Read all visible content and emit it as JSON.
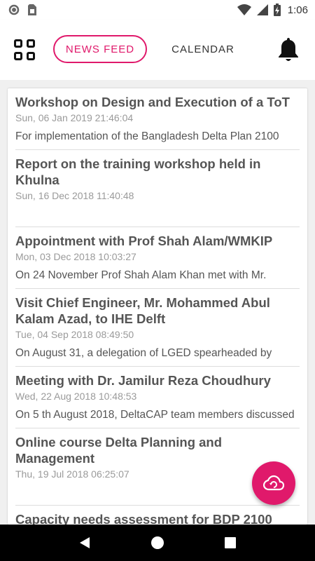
{
  "status_bar": {
    "time": "1:06",
    "icons": [
      "circle-icon",
      "sim-card-icon",
      "wifi-icon",
      "signal-icon",
      "battery-charging-icon"
    ]
  },
  "header": {
    "tabs": [
      {
        "label": "NEWS FEED",
        "active": true
      },
      {
        "label": "CALENDAR",
        "active": false
      }
    ],
    "accent_color": "#e0196b"
  },
  "feed": {
    "items": [
      {
        "title": "Workshop on Design and Execution of a ToT",
        "date": "Sun, 06 Jan 2019 21:46:04",
        "summary": "For implementation of the Bangladesh Delta Plan 2100"
      },
      {
        "title": "Report on the training workshop held in Khulna",
        "date": "Sun, 16 Dec 2018 11:40:48",
        "summary": ""
      },
      {
        "title": "Appointment with Prof Shah Alam/WMKIP",
        "date": "Mon, 03 Dec 2018 10:03:27",
        "summary": "On 24 November Prof Shah Alam Khan met with Mr."
      },
      {
        "title": "Visit Chief Engineer, Mr. Mohammed Abul Kalam Azad, to IHE Delft",
        "date": "Tue, 04 Sep 2018 08:49:50",
        "summary": "On August 31, a delegation of LGED spearheaded by"
      },
      {
        "title": "Meeting with Dr. Jamilur Reza Choudhury",
        "date": "Wed, 22 Aug 2018 10:48:53",
        "summary": "On 5 th August 2018, DeltaCAP team members discussed"
      },
      {
        "title": "Online course Delta Planning and Management",
        "date": "Thu, 19 Jul 2018 06:25:07",
        "summary": ""
      },
      {
        "title": "Capacity needs assessment for BDP 2100",
        "date": "",
        "summary": ""
      }
    ]
  }
}
